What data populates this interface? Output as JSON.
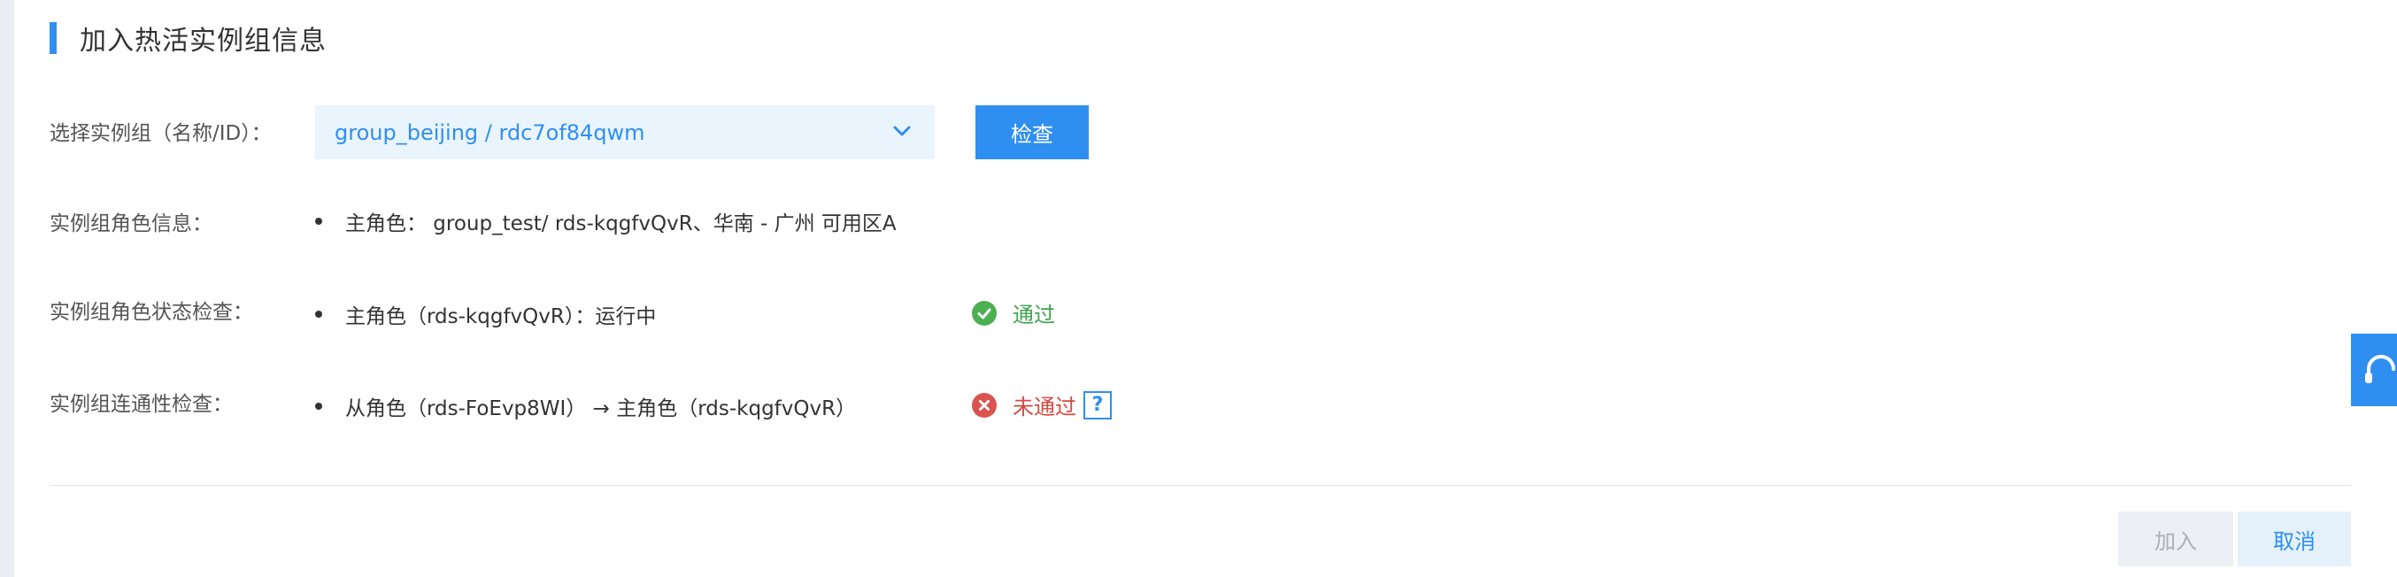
{
  "section": {
    "title": "加入热活实例组信息"
  },
  "select_row": {
    "label": "选择实例组（名称/ID）：",
    "value": "group_beijing / rdc7of84qwm",
    "check_button": "检查"
  },
  "role_info": {
    "label": "实例组角色信息：",
    "item": "主角色：  group_test/ rds-kqgfvQvR、华南 - 广州 可用区A"
  },
  "role_status": {
    "label": "实例组角色状态检查：",
    "item": "主角色（rds-kqgfvQvR）：运行中",
    "result": "通过",
    "result_color": "#3fa34d"
  },
  "connectivity": {
    "label": "实例组连通性检查：",
    "item": "从角色（rds-FoEvp8WI） → 主角色（rds-kqgfvQvR）",
    "result": "未通过",
    "result_color": "#d9473f",
    "help_label": "?"
  },
  "footer": {
    "join_button": "加入",
    "cancel_button": "取消"
  },
  "icons": {
    "dropdown": "chevron-down-icon",
    "pass": "check-circle-icon",
    "fail": "x-circle-icon",
    "help": "question-icon",
    "support": "headset-icon"
  },
  "colors": {
    "accent": "#2f8ff0"
  }
}
